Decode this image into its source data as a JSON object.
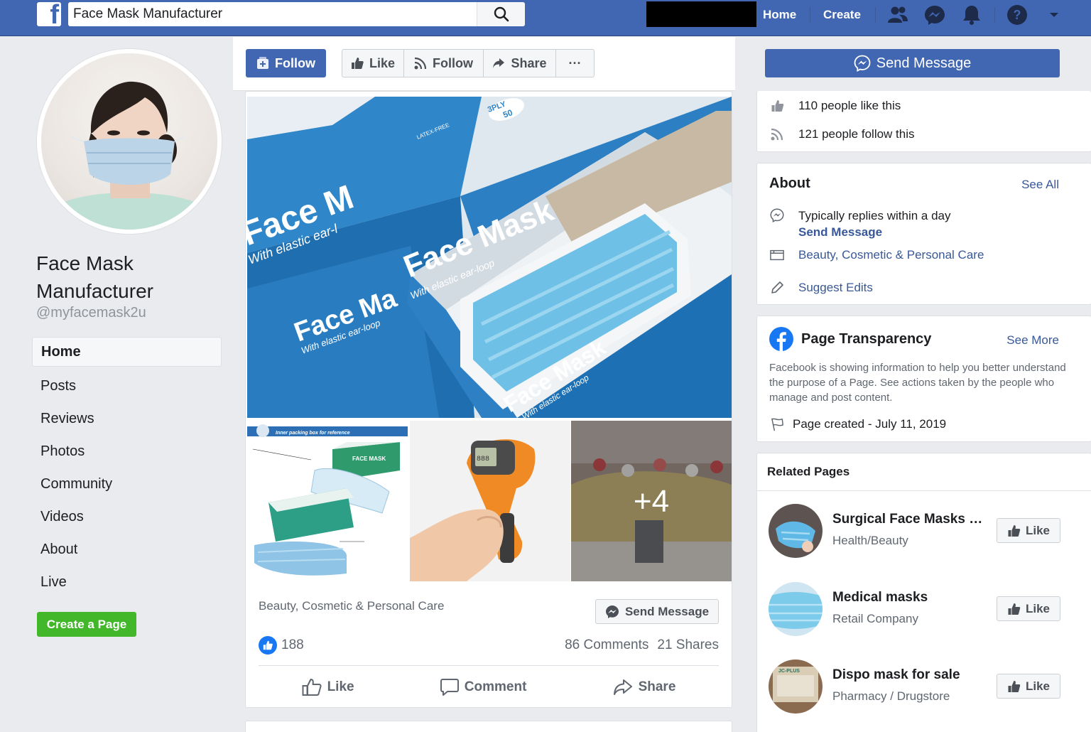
{
  "header": {
    "search_value": "Face Mask Manufacturer",
    "nav": {
      "home": "Home",
      "create": "Create"
    }
  },
  "profile": {
    "name": "Face Mask Manufacturer",
    "handle": "@myfacemask2u"
  },
  "left_nav": {
    "items": [
      "Home",
      "Posts",
      "Reviews",
      "Photos",
      "Community",
      "Videos",
      "About",
      "Live"
    ],
    "active": "Home",
    "create_page": "Create a Page"
  },
  "action_bar": {
    "follow_primary": "Follow",
    "like": "Like",
    "follow": "Follow",
    "share": "Share",
    "more": "···"
  },
  "post": {
    "hero_box_text_1": "Face Mask",
    "hero_box_sub_1": "With elastic ear-loop",
    "hero_box_text_2": "Face M",
    "hero_box_sub_2": "With elastic ear-l",
    "hero_box_text_3": "Face Ma",
    "hero_box_sub_3": "With elastic ear-loop",
    "hero_box_text_4": "Face Mask",
    "hero_box_sub_4": "With elastic ear-loop",
    "ply_label": "3PLY",
    "ply_count": "50",
    "latex_label": "LATEX-FREE",
    "thumb1_banner": "Inner packing box for reference",
    "thumb1_box_label": "FACE MASK",
    "thermometer_reading": "888",
    "more_photos": "+4",
    "category": "Beauty, Cosmetic & Personal Care",
    "send_message": "Send Message",
    "like_count": "188",
    "comments": "86 Comments",
    "shares": "21 Shares",
    "actions": {
      "like": "Like",
      "comment": "Comment",
      "share": "Share"
    }
  },
  "right": {
    "send_message": "Send Message",
    "likes_text": "110 people like this",
    "follows_text": "121 people follow this",
    "about": {
      "title": "About",
      "see_all": "See All",
      "reply_time": "Typically replies within a day",
      "send_message": "Send Message",
      "category": "Beauty, Cosmetic & Personal Care",
      "suggest_edits": "Suggest Edits"
    },
    "transparency": {
      "title": "Page Transparency",
      "see_more": "See More",
      "description": "Facebook is showing information to help you better understand the purpose of a Page. See actions taken by the people who manage and post content.",
      "created": "Page created - July 11, 2019"
    },
    "related": {
      "title": "Related Pages",
      "like_label": "Like",
      "items": [
        {
          "name": "Surgical Face Masks Ma...",
          "category": "Health/Beauty"
        },
        {
          "name": "Medical masks",
          "category": "Retail Company"
        },
        {
          "name": "Dispo mask for sale",
          "category": "Pharmacy / Drugstore"
        }
      ],
      "thumb3_label": "JC-PLUS"
    }
  },
  "colors": {
    "brand": "#4267b2",
    "link": "#385898",
    "green": "#42b72a",
    "like_blue": "#1877f2"
  }
}
